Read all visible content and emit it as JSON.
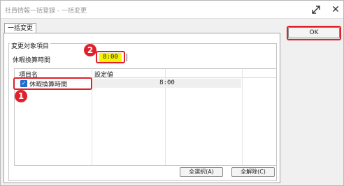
{
  "window": {
    "title": "社員情報一括登録 - 一括変更",
    "close_glyph": "✕",
    "maximize_icon": "expand-arrows"
  },
  "tabs": [
    {
      "label": "一括変更"
    }
  ],
  "group": {
    "title": "変更対象項目",
    "field_label": "休暇換算時間",
    "field_value": "8:00"
  },
  "grid": {
    "columns": [
      "項目名",
      "設定値"
    ],
    "rows": [
      {
        "checked": true,
        "name": "休暇換算時間",
        "value": "8:00"
      }
    ]
  },
  "buttons": {
    "ok": "OK",
    "select_all": "全選択(A)",
    "clear_all": "全解除(C)"
  },
  "annotations": {
    "badge_1": "1",
    "badge_2": "2"
  },
  "colors": {
    "highlight": "#e0202a",
    "value_bg": "#f6f500",
    "checkbox": "#1e6fd0"
  }
}
